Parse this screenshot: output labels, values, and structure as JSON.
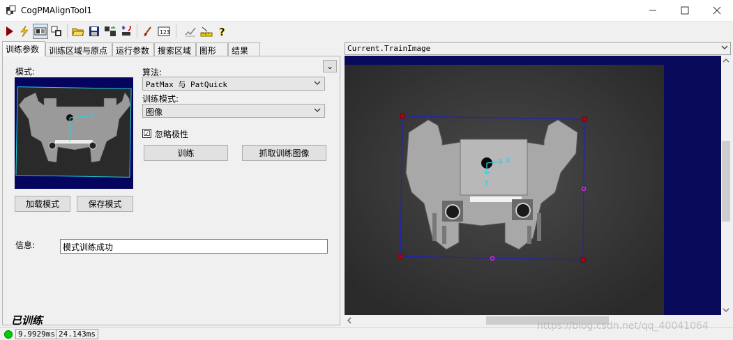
{
  "window": {
    "title": "CogPMAlignTool1"
  },
  "toolbar": {
    "icons": [
      "run-icon",
      "electric-run-icon",
      "show-image-icon",
      "live-display-icon",
      "open-icon",
      "save-icon",
      "tool-settings-icon",
      "reset-icon",
      "brush-icon",
      "numeric-icon",
      "edit-icon",
      "ruler-icon",
      "help-icon"
    ]
  },
  "tabs": [
    "训练参数",
    "训练区域与原点",
    "运行参数",
    "搜索区域",
    "图形",
    "结果"
  ],
  "train": {
    "pattern_label": "模式:",
    "algorithm_label": "算法:",
    "algorithm_value": "PatMax 与 PatQuick",
    "train_mode_label": "训练模式:",
    "train_mode_value": "图像",
    "ignore_polarity_label": "忽略极性",
    "ignore_polarity_checked": "☑",
    "train_button": "训练",
    "grab_button": "抓取训练图像",
    "load_button": "加载模式",
    "save_button": "保存模式",
    "info_label": "信息:",
    "info_value": "模式训练成功",
    "trained_status": "已训练",
    "collapse_glyph": "⌄"
  },
  "status": {
    "time1": "9.9929ms",
    "time2": "24.143ms"
  },
  "display": {
    "image_name": "Current.TrainImage",
    "watermark": "https://blog.csdn.net/qq_40041064"
  },
  "graphics": {
    "axis_x": "X",
    "axis_y": "Y"
  },
  "colors": {
    "display_bg": "#0a0a5a",
    "region": "#2020c0",
    "handle": "#c00000",
    "axis": "#30d0e0",
    "status_ok": "#00d000"
  }
}
